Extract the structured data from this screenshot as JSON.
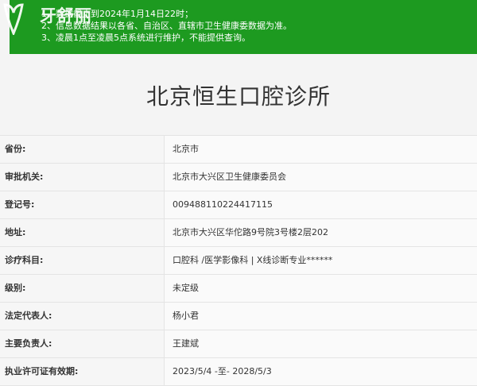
{
  "notice": {
    "lines": [
      "1、数据截止到2024年1月14日22时；",
      "2、信息数据结果以各省、自治区、直辖市卫生健康委数据为准。",
      "3、凌晨1点至凌晨5点系统进行维护，不能提供查询。"
    ],
    "bg_color": "#1d9a20"
  },
  "logo": {
    "text": "牙舒丽"
  },
  "page_title": "北京恒生口腔诊所",
  "rows": [
    {
      "label": "省份:",
      "value": "北京市"
    },
    {
      "label": "审批机关:",
      "value": "北京市大兴区卫生健康委员会"
    },
    {
      "label": "登记号:",
      "value": "009488110224417115"
    },
    {
      "label": "地址:",
      "value": "北京市大兴区华佗路9号院3号楼2层202"
    },
    {
      "label": "诊疗科目:",
      "value": "口腔科 /医学影像科  |  X线诊断专业******"
    },
    {
      "label": "级别:",
      "value": "未定级"
    },
    {
      "label": "法定代表人:",
      "value": "杨小君"
    },
    {
      "label": "主要负责人:",
      "value": "王建斌"
    },
    {
      "label": "执业许可证有效期:",
      "value": "2023/5/4 -至- 2028/5/3"
    }
  ]
}
